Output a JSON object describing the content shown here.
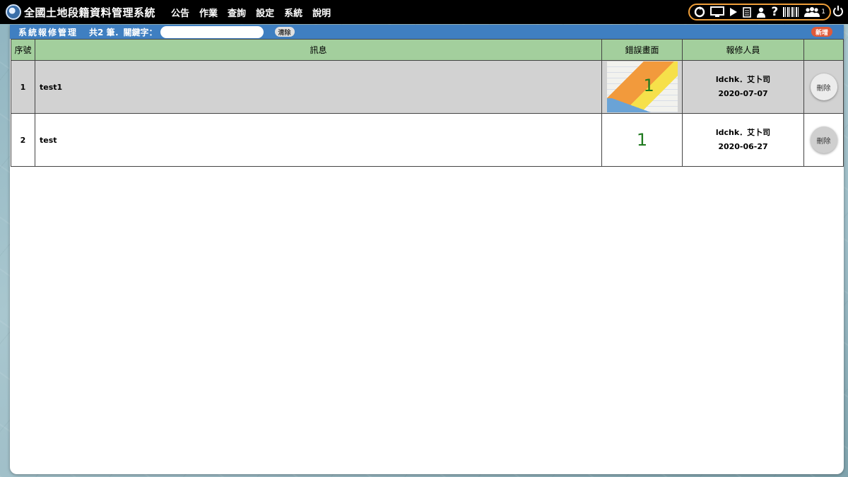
{
  "app": {
    "title": "全國土地段籍資料管理系統"
  },
  "menu": [
    {
      "label": "公告"
    },
    {
      "label": "作業"
    },
    {
      "label": "查詢"
    },
    {
      "label": "設定"
    },
    {
      "label": "系統"
    },
    {
      "label": "說明"
    }
  ],
  "toolbar": {
    "icons": [
      "refresh-icon",
      "monitor-icon",
      "play-icon",
      "document-icon",
      "user-icon",
      "help-icon",
      "barcode-icon",
      "users-icon",
      "power-icon"
    ],
    "users_badge": "1",
    "accent_color": "#f0a03a"
  },
  "panel": {
    "title": "系統報修管理",
    "count_text": "共2 筆．關鍵字：",
    "search_value": "",
    "clear_label": "清除",
    "add_label": "新增",
    "header_color": "#3f7fc1"
  },
  "table": {
    "header_color": "#a3cf9d",
    "columns": [
      "序號",
      "訊息",
      "錯誤畫面",
      "報修人員",
      ""
    ],
    "rows": [
      {
        "index": "1",
        "message": "test1",
        "screen_number": "1",
        "user": "ldchk．艾卜司",
        "date": "2020-07-07",
        "action": "刪除",
        "selected": true,
        "has_thumbnail": true
      },
      {
        "index": "2",
        "message": "test",
        "screen_number": "1",
        "user": "ldchk．艾卜司",
        "date": "2020-06-27",
        "action": "刪除",
        "selected": false,
        "has_thumbnail": false
      }
    ]
  }
}
